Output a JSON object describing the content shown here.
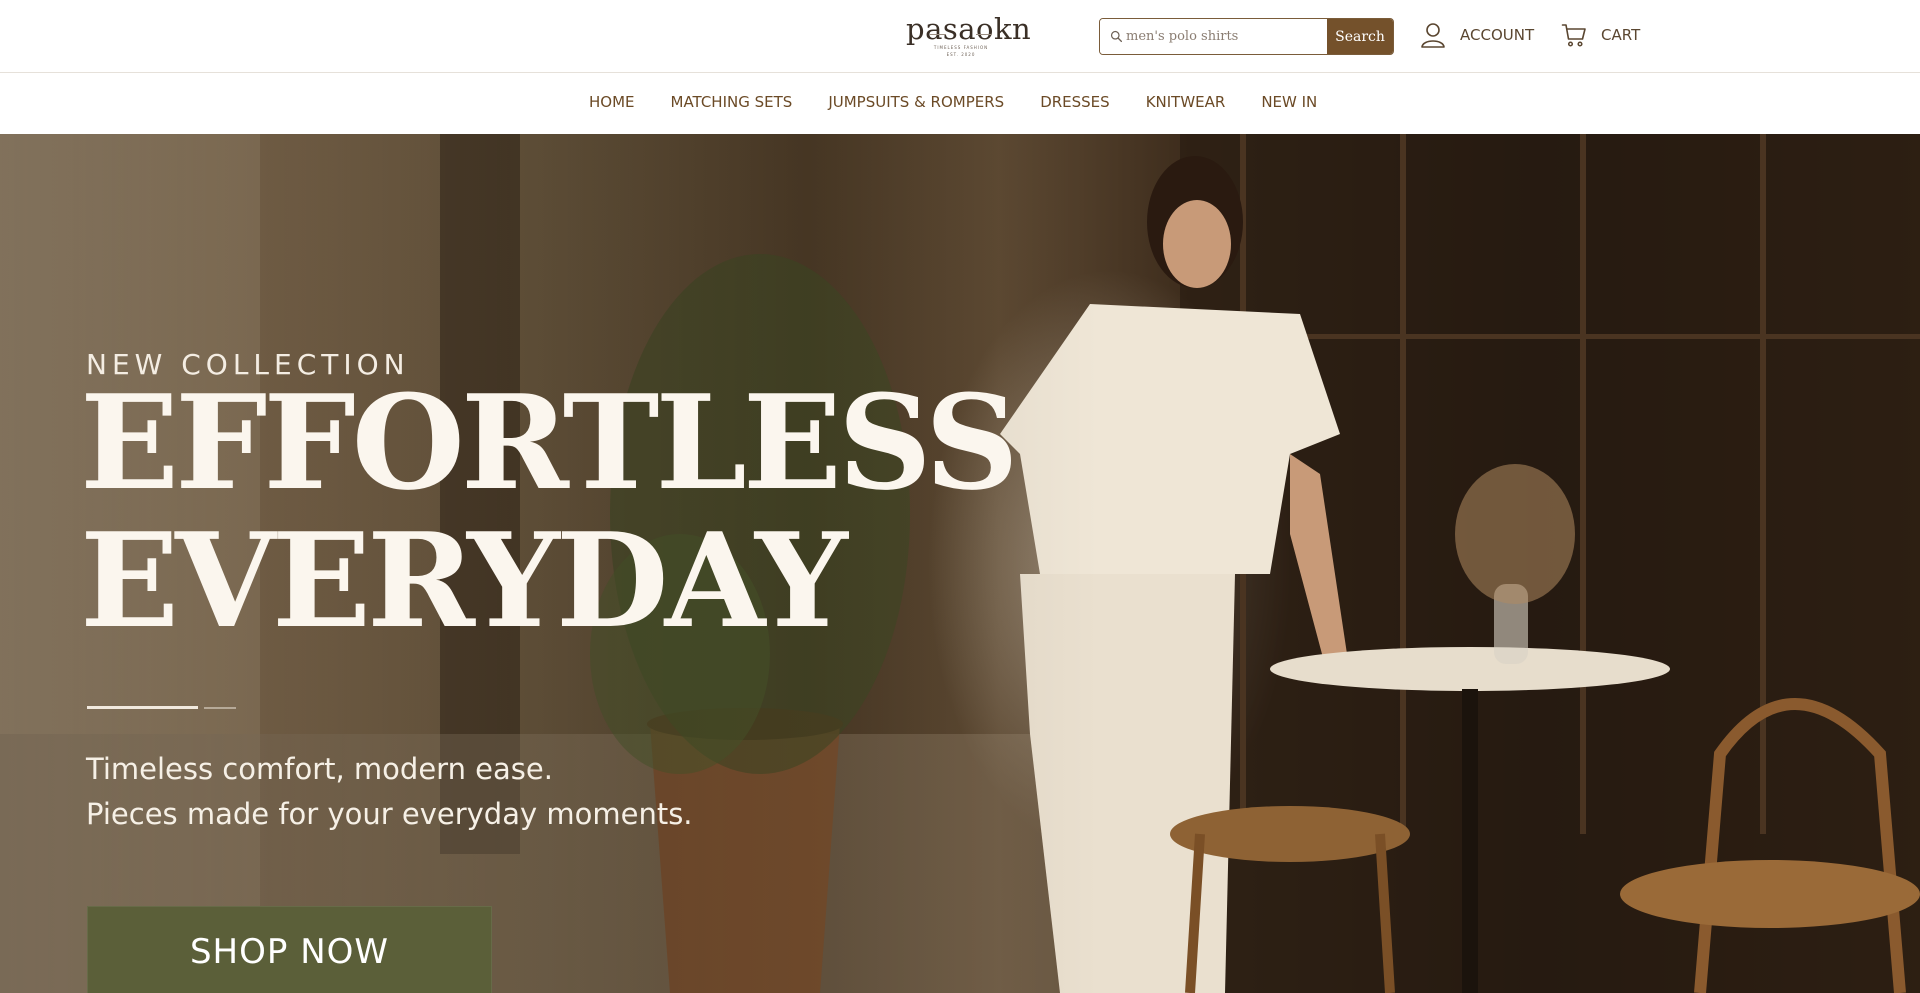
{
  "brand": {
    "name": "pasaokn",
    "tagline": "TIMELESS FASHION",
    "est": "EST. 2020"
  },
  "search": {
    "placeholder": "men's polo shirts",
    "button_label": "Search",
    "icon": "search-icon"
  },
  "header": {
    "account_label": "ACCOUNT",
    "account_icon": "user-icon",
    "cart_label": "CART",
    "cart_icon": "cart-icon"
  },
  "nav": {
    "items": [
      {
        "label": "HOME"
      },
      {
        "label": "MATCHING SETS"
      },
      {
        "label": "JUMPSUITS & ROMPERS"
      },
      {
        "label": "DRESSES"
      },
      {
        "label": "KNITWEAR"
      },
      {
        "label": "NEW IN"
      }
    ]
  },
  "hero": {
    "eyebrow": "NEW COLLECTION",
    "headline_line1": "EFFORTLESS",
    "headline_line2": "EVERYDAY",
    "subtext_line1": "Timeless comfort, modern ease.",
    "subtext_line2": "Pieces made for your everyday moments.",
    "cta_label": "SHOP NOW"
  },
  "colors": {
    "accent_brown": "#74512b",
    "nav_text": "#6b4a26",
    "cta_olive": "#5b5f39",
    "hero_text": "#fbf6ee"
  }
}
